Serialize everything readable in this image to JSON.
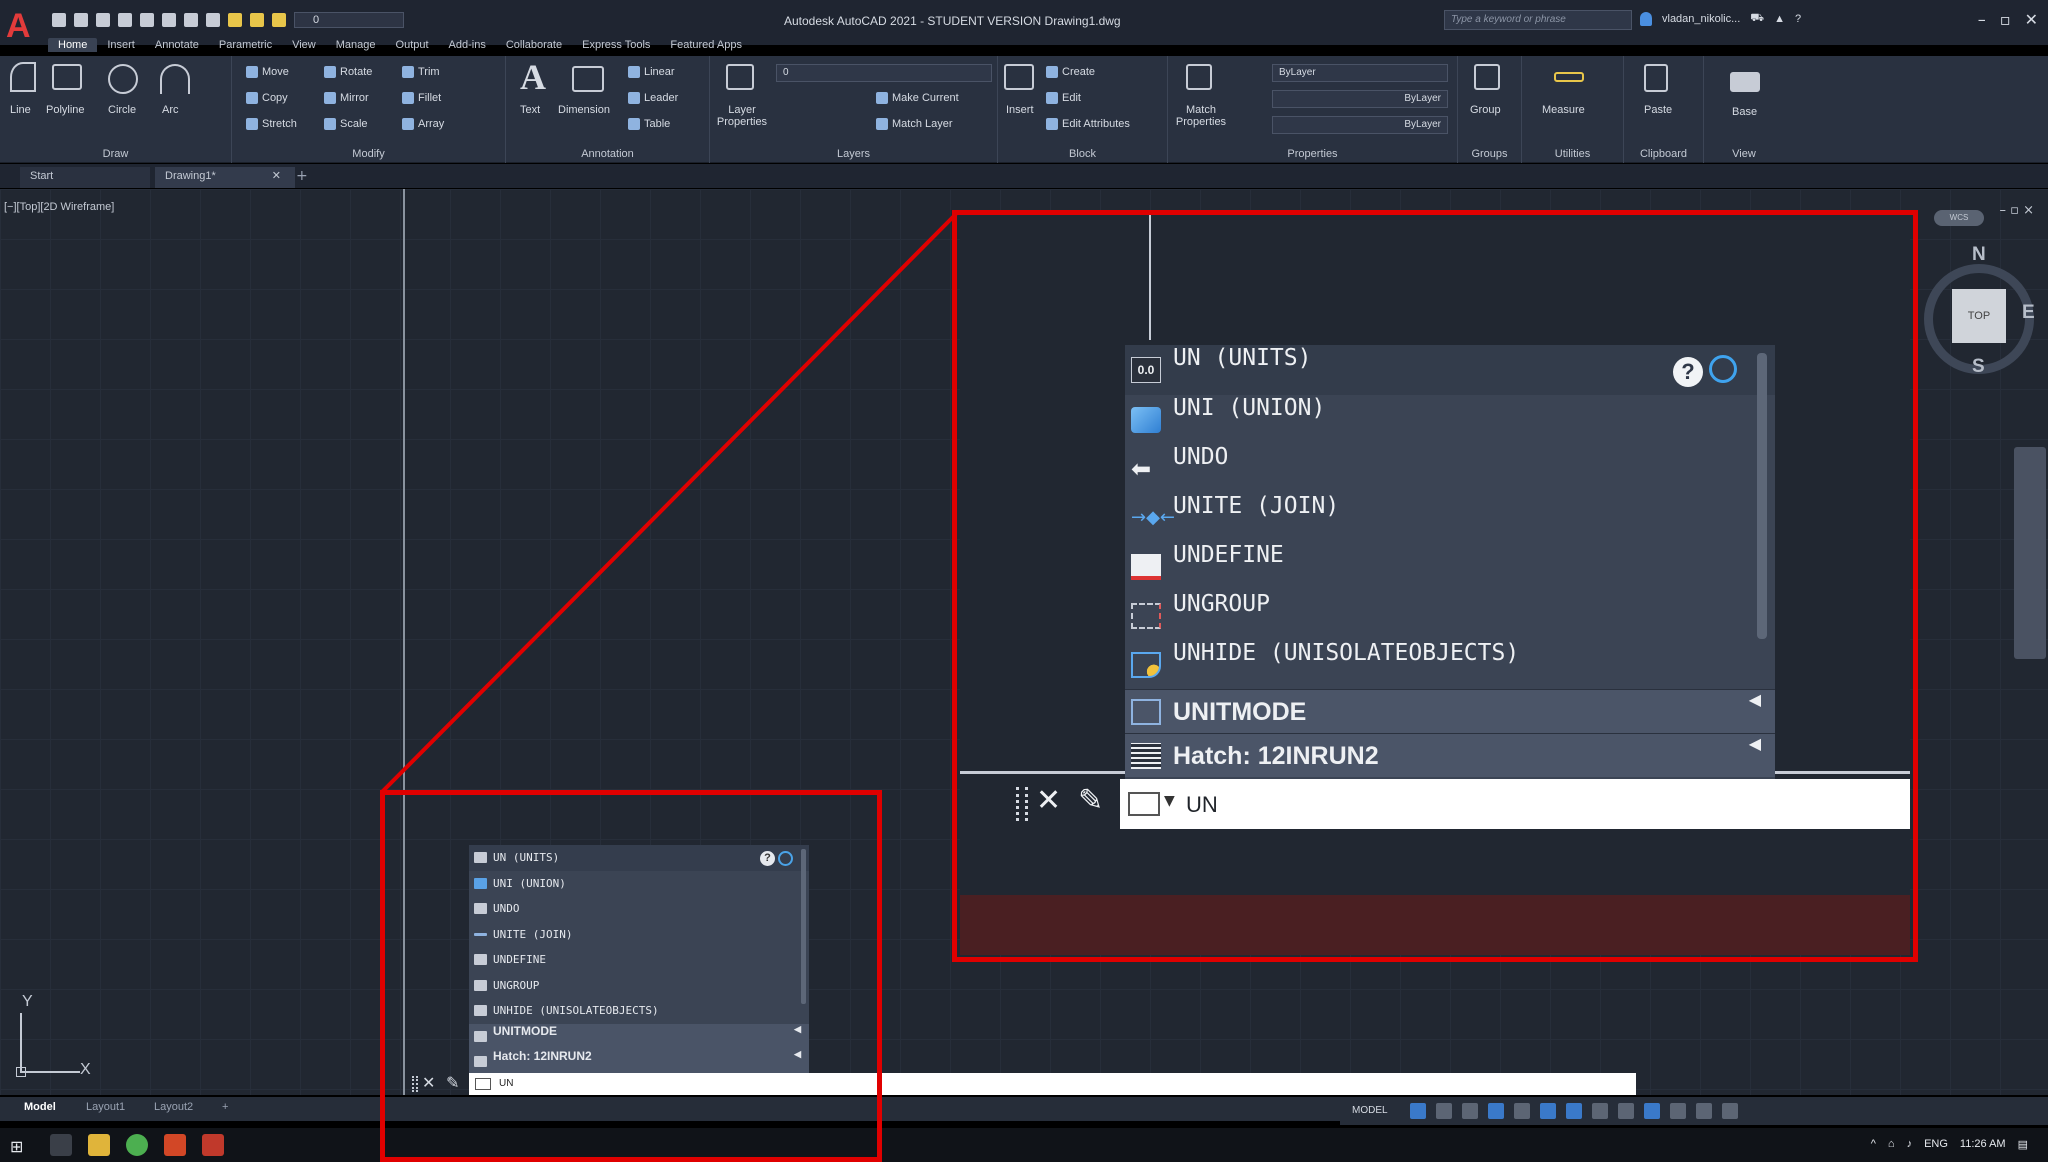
{
  "title_bar": {
    "app_title": "Autodesk AutoCAD 2021 - STUDENT VERSION   Drawing1.dwg",
    "search_placeholder": "Type a keyword or phrase",
    "user_name": "vladan_nikolic...",
    "qat_layer": "0"
  },
  "ribbon_tabs": [
    "Home",
    "Insert",
    "Annotate",
    "Parametric",
    "View",
    "Manage",
    "Output",
    "Add-ins",
    "Collaborate",
    "Express Tools",
    "Featured Apps"
  ],
  "ribbon": {
    "draw": {
      "label": "Draw",
      "buttons": [
        "Line",
        "Polyline",
        "Circle",
        "Arc"
      ]
    },
    "modify": {
      "label": "Modify",
      "items": [
        "Move",
        "Rotate",
        "Trim",
        "Copy",
        "Mirror",
        "Fillet",
        "Stretch",
        "Scale",
        "Array"
      ]
    },
    "annotation": {
      "label": "Annotation",
      "buttons": [
        "Text",
        "Dimension"
      ],
      "items": [
        "Linear",
        "Leader",
        "Table"
      ]
    },
    "layers": {
      "label": "Layers",
      "button": "Layer Properties",
      "current": "0",
      "items": [
        "Make Current",
        "Match Layer"
      ]
    },
    "block": {
      "label": "Block",
      "button": "Insert",
      "items": [
        "Create",
        "Edit",
        "Edit Attributes"
      ]
    },
    "properties": {
      "label": "Properties",
      "button": "Match Properties",
      "values": [
        "ByLayer",
        "ByLayer",
        "ByLayer"
      ]
    },
    "groups": {
      "label": "Groups",
      "button": "Group"
    },
    "utilities": {
      "label": "Utilities",
      "button": "Measure"
    },
    "clipboard": {
      "label": "Clipboard",
      "button": "Paste"
    },
    "view": {
      "label": "View",
      "button": "Base"
    }
  },
  "file_tabs": {
    "start": "Start",
    "drawing": "Drawing1*",
    "close": "✕",
    "add": "+"
  },
  "viewport": {
    "label": "[−][Top][2D Wireframe]",
    "controls": "– ▫ ×"
  },
  "viewcube": {
    "top": "TOP",
    "north": "N",
    "south": "S",
    "east": "E",
    "wcs": "WCS"
  },
  "ucs": {
    "x": "X",
    "y": "Y"
  },
  "autocomplete": {
    "items": [
      {
        "text": "UN (UNITS)",
        "icon": "units-icon"
      },
      {
        "text": "UNI (UNION)",
        "icon": "union-icon"
      },
      {
        "text": "UNDO",
        "icon": "undo-icon"
      },
      {
        "text": "UNITE (JOIN)",
        "icon": "join-icon"
      },
      {
        "text": "UNDEFINE",
        "icon": "undefine-icon"
      },
      {
        "text": "UNGROUP",
        "icon": "ungroup-icon"
      },
      {
        "text": "UNHIDE (UNISOLATEOBJECTS)",
        "icon": "unhide-icon"
      }
    ],
    "categories": [
      {
        "text": "UNITMODE",
        "icon": "sysvar-icon"
      },
      {
        "text": "Hatch: 12INRUN2",
        "icon": "hatch-icon"
      }
    ],
    "units_glyph": "0.0",
    "help": "?"
  },
  "command_line": {
    "value": "UN",
    "close": "✕",
    "wrench": "🔧"
  },
  "layout_tabs": [
    "Model",
    "Layout1",
    "Layout2",
    "+"
  ],
  "status_bar": {
    "mode": "MODEL"
  },
  "taskbar": {
    "lang": "ENG",
    "time": "11:26 AM"
  },
  "colors": {
    "highlight_red": "#e00000",
    "canvas": "#212731",
    "ribbon": "#293140"
  }
}
